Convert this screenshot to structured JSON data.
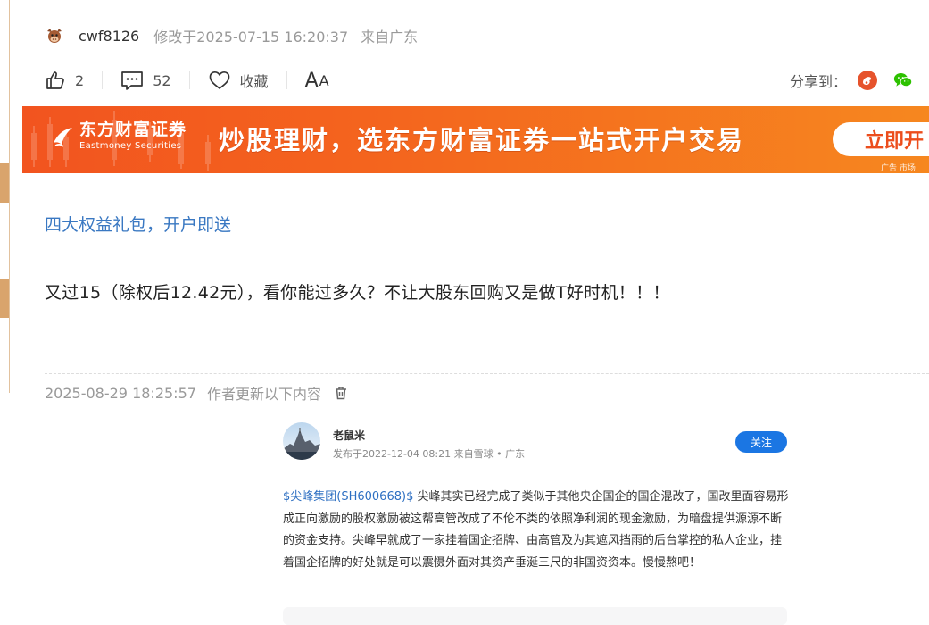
{
  "author": {
    "name": "cwf8126",
    "modified": "修改于2025-07-15 16:20:37",
    "location": "来自广东",
    "avatar_icon": "cow-avatar-icon"
  },
  "actions": {
    "like_count": "2",
    "comment_count": "52",
    "favorite_label": "收藏",
    "font_size_large": "A",
    "font_size_small": "A",
    "share_label": "分享到："
  },
  "banner": {
    "logo_cn": "东方财富证券",
    "logo_en": "Eastmoney Securities",
    "slogan": "炒股理财，选东方财富证券一站式开户交易",
    "cta": "立即开",
    "ad_tag": "广告 市场",
    "colors": {
      "start": "#f2541f",
      "end": "#f6871f"
    }
  },
  "promo_link": "四大权益礼包，开户即送",
  "post_body": "又过15（除权后12.42元），看你能过多久？不让大股东回购又是做T好时机！！！",
  "update": {
    "timestamp": "2025-08-29 18:25:57",
    "note": "作者更新以下内容"
  },
  "quoted_post": {
    "user": "老鼠米",
    "meta": "发布于2022-12-04 08:21  来自雪球  •  广东",
    "follow_label": "关注",
    "stock_link": "$尖峰集团(SH600668)$",
    "text": " 尖峰其实已经完成了类似于其他央企国企的国企混改了，国改里面容易形成正向激励的股权激励被这帮高管改成了不伦不类的依照净利润的现金激励，为暗盘提供源源不断的资金支持。尖峰早就成了一家挂着国企招牌、由高管及为其遮风挡雨的后台掌控的私人企业，挂着国企招牌的好处就是可以震慑外面对其资产垂涎三尺的非国资资本。慢慢熬吧！"
  },
  "colors": {
    "link": "#3a78c2",
    "follow_button": "#1b76e3",
    "weibo": "#e6532c",
    "wechat": "#2dc100"
  }
}
